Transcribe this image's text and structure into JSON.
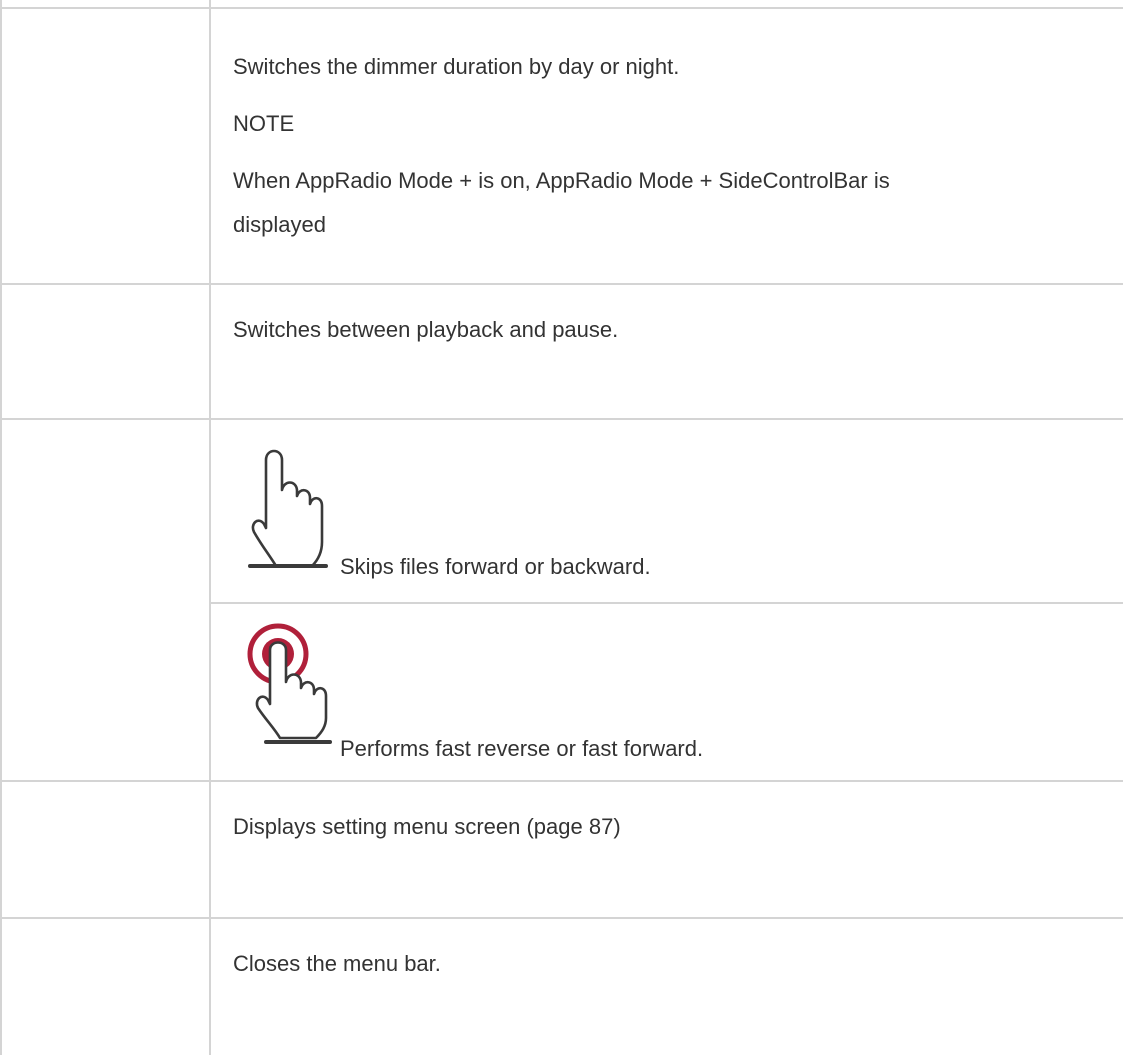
{
  "rows": [
    {
      "paragraphs": [
        "Switches the dimmer duration by day or night.",
        "NOTE",
        "When AppRadio Mode + is on, AppRadio Mode + SideControlBar is",
        "displayed"
      ]
    },
    {
      "text": "Switches between playback and pause."
    },
    {
      "subrows": [
        {
          "icon": "tap-gesture-icon",
          "text": "Skips files forward or backward."
        },
        {
          "icon": "touch-and-hold-gesture-icon",
          "text": "Performs fast reverse or fast forward."
        }
      ]
    },
    {
      "text": "Displays setting menu screen (page 87)"
    },
    {
      "text": "Closes the menu bar."
    }
  ],
  "colors": {
    "border": "#d4d4d4",
    "text": "#333333",
    "hold_ring": "#b0203a",
    "hand_stroke": "#3a3a3a"
  }
}
